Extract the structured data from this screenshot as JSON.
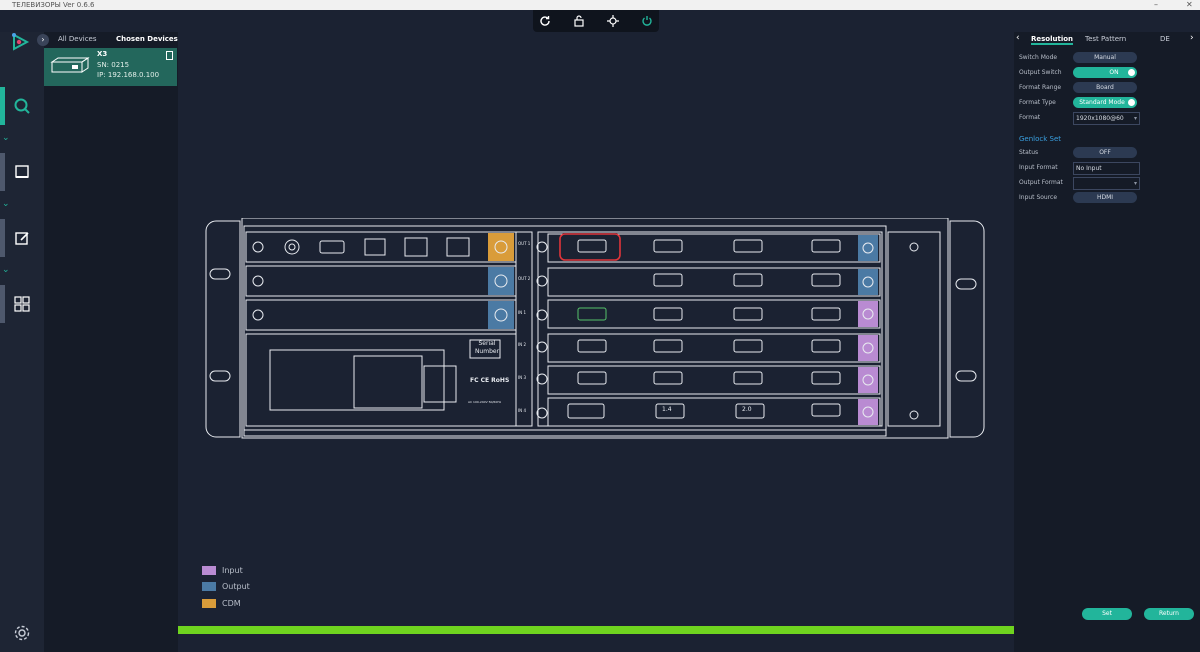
{
  "window": {
    "title": "ТЕЛЕВИЗОРЫ  Ver 0.6.6",
    "minimize": "–",
    "close": "✕"
  },
  "toolbar": {
    "items": [
      "refresh-icon",
      "unlock-icon",
      "locate-icon",
      "power-icon"
    ]
  },
  "sidebar": {
    "items": [
      "search-icon",
      "screen-icon",
      "edit-icon",
      "grid-icon"
    ],
    "settings": "gear-icon"
  },
  "devices": {
    "tab_all": "All Devices",
    "tab_chosen": "Chosen Devices",
    "card": {
      "name": "X3",
      "sn": "SN: 0215",
      "ip": "IP: 192.168.0.100"
    }
  },
  "legend": {
    "input": "Input",
    "output": "Output",
    "cdm": "CDM",
    "colors": {
      "input": "#b98bd2",
      "output": "#4b7aa4",
      "cdm": "#d99c3a"
    }
  },
  "device_panel": {
    "slot_labels": [
      "OUT 1",
      "OUT 2",
      "IN 1",
      "IN 2",
      "IN 3",
      "IN 4"
    ],
    "serial_label": "Serial Number",
    "cert_text": "FC CE RoHS",
    "power_spec": "AC 100-240V 50/60Hz",
    "port_labels": [
      "1.4",
      "2.0"
    ]
  },
  "progress": {
    "value": 100
  },
  "right_panel": {
    "tabs": [
      "Resolution",
      "Test Pattern",
      "DE"
    ],
    "resolution": {
      "switch_mode_label": "Switch Mode",
      "switch_mode_value": "Manual",
      "output_switch_label": "Output Switch",
      "output_switch_value": "ON",
      "format_range_label": "Format Range",
      "format_range_value": "Board",
      "format_type_label": "Format Type",
      "format_type_value": "Standard Mode",
      "format_label": "Format",
      "format_value": "1920x1080@60"
    },
    "genlock": {
      "title": "Genlock Set",
      "status_label": "Status",
      "status_value": "OFF",
      "input_format_label": "Input Format",
      "input_format_value": "No Input",
      "output_format_label": "Output Format",
      "output_format_value": "",
      "input_source_label": "Input Source",
      "input_source_value": "HDMI"
    },
    "set_button": "Set",
    "return_button": "Return"
  }
}
